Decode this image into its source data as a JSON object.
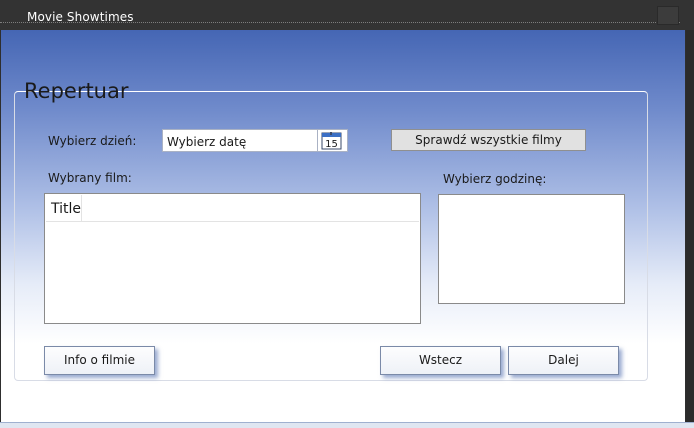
{
  "window": {
    "title": "Movie Showtimes"
  },
  "group": {
    "title": "Repertuar"
  },
  "labels": {
    "choose_day": "Wybierz dzień:",
    "selected_movie": "Wybrany film:",
    "choose_time": "Wybierz godzinę:"
  },
  "datepicker": {
    "placeholder": "Wybierz datę",
    "calendar_day": "15"
  },
  "buttons": {
    "check_all": "Sprawdź wszystkie filmy",
    "info": "Info o filmie",
    "back": "Wstecz",
    "next": "Dalej"
  },
  "movies_list": {
    "columns": [
      "Title"
    ],
    "rows": []
  },
  "times_list": {
    "items": []
  },
  "colors": {
    "accent": "#4566b4",
    "text": "#1a1a1a",
    "titlebar": "#333333"
  }
}
